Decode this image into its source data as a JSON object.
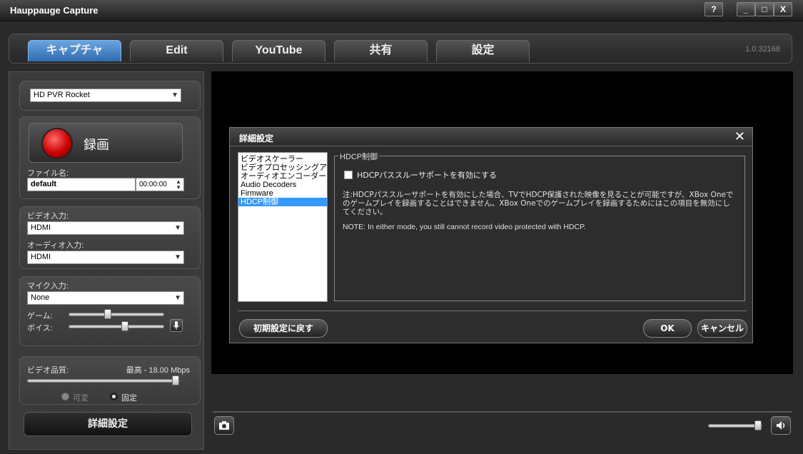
{
  "window": {
    "title": "Hauppauge Capture",
    "help_label": "?",
    "minimize_label": "_",
    "maximize_label": "□",
    "close_label": "X"
  },
  "tabs": [
    {
      "label": "キャプチャ",
      "active": true
    },
    {
      "label": "Edit",
      "active": false
    },
    {
      "label": "YouTube",
      "active": false
    },
    {
      "label": "共有",
      "active": false
    },
    {
      "label": "設定",
      "active": false
    }
  ],
  "version": "1.0.32168",
  "left": {
    "device": "HD PVR Rocket",
    "record_label": "録画",
    "filename_label": "ファイル名:",
    "filename_value": "default",
    "duration_value": "00:00:00",
    "video_input_label": "ビデオ入力:",
    "video_input_value": "HDMI",
    "audio_input_label": "オーディオ入力:",
    "audio_input_value": "HDMI",
    "mic_input_label": "マイク入力:",
    "mic_input_value": "None",
    "game_label": "ゲーム:",
    "voice_label": "ボイス:",
    "game_level": 0.4,
    "voice_level": 0.6,
    "quality_label": "ビデオ品質:",
    "quality_value": "最高 - 18.00 Mbps",
    "quality_level": 1.0,
    "variable_label": "可変",
    "fixed_label": "固定",
    "advanced_label": "詳細設定"
  },
  "dialog": {
    "title": "詳細設定",
    "close_label": "✕",
    "list": [
      {
        "label": "ビデオスケーラー",
        "selected": false
      },
      {
        "label": "ビデオプロセッシングアンプ",
        "selected": false
      },
      {
        "label": "オーディオエンコーダー",
        "selected": false
      },
      {
        "label": "Audio Decoders",
        "selected": false
      },
      {
        "label": "Firmware",
        "selected": false
      },
      {
        "label": "HDCP制御",
        "selected": true
      }
    ],
    "section_title": "HDCP制御",
    "checkbox_label": "HDCPパススルーサポートを有効にする",
    "note_jp": "注:HDCPパススルーサポートを有効にした場合、TVでHDCP保護された映像を見ることが可能ですが、XBox Oneでのゲームプレイを録画することはできません。XBox Oneでのゲームプレイを録画するためにはこの項目を無効にしてください。",
    "note_en": "NOTE: In either mode, you still cannot record video protected with HDCP.",
    "reset_label": "初期設定に戻す",
    "ok_label": "OK",
    "cancel_label": "キャンセル"
  },
  "bottom": {
    "volume_level": 1.0
  }
}
